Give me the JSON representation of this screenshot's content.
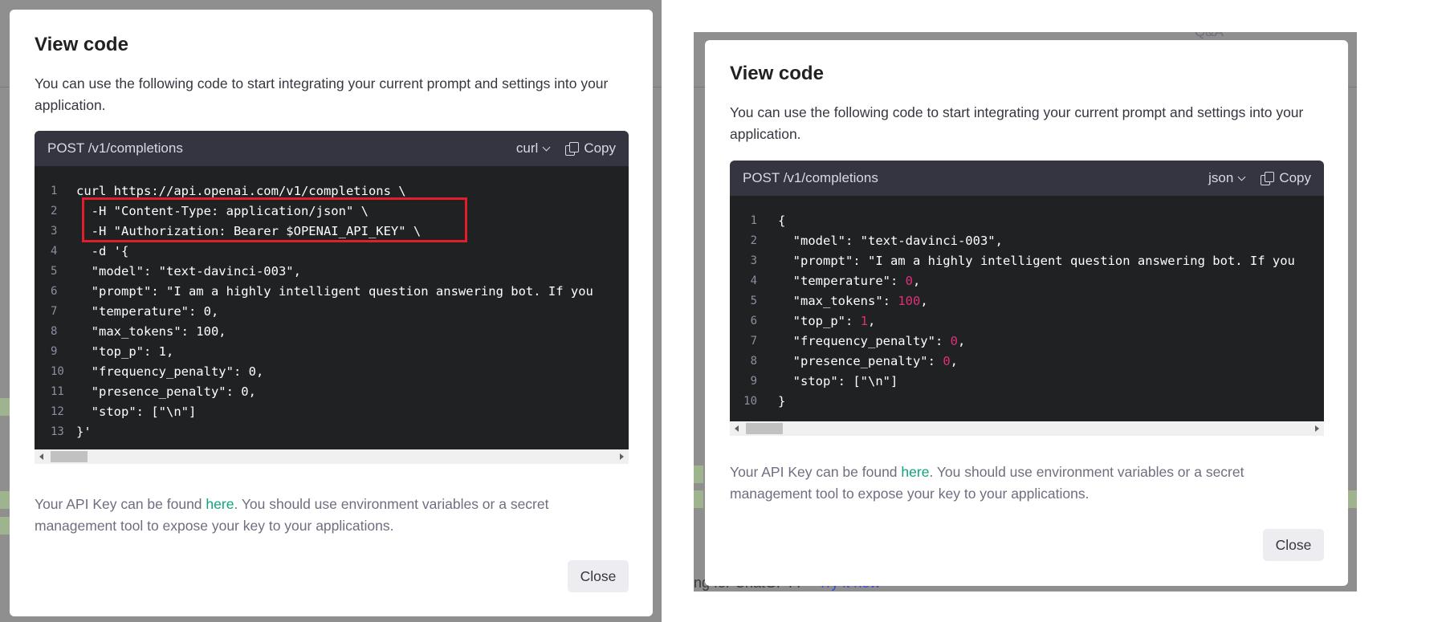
{
  "left": {
    "title": "View code",
    "description": "You can use the following code to start integrating your current prompt and settings into your application.",
    "endpoint": "POST /v1/completions",
    "language": "curl",
    "copy_label": "Copy",
    "code_lines": [
      {
        "n": "1",
        "text": "curl https://api.openai.com/v1/completions \\"
      },
      {
        "n": "2",
        "text": "  -H \"Content-Type: application/json\" \\"
      },
      {
        "n": "3",
        "text": "  -H \"Authorization: Bearer $OPENAI_API_KEY\" \\"
      },
      {
        "n": "4",
        "text": "  -d '{"
      },
      {
        "n": "5",
        "text": "  \"model\": \"text-davinci-003\","
      },
      {
        "n": "6",
        "text": "  \"prompt\": \"I am a highly intelligent question answering bot. If you"
      },
      {
        "n": "7",
        "text": "  \"temperature\": 0,"
      },
      {
        "n": "8",
        "text": "  \"max_tokens\": 100,"
      },
      {
        "n": "9",
        "text": "  \"top_p\": 1,"
      },
      {
        "n": "10",
        "text": "  \"frequency_penalty\": 0,"
      },
      {
        "n": "11",
        "text": "  \"presence_penalty\": 0,"
      },
      {
        "n": "12",
        "text": "  \"stop\": [\"\\n\"]"
      },
      {
        "n": "13",
        "text": "}'"
      }
    ],
    "note_before": "Your API Key can be found ",
    "note_link": "here",
    "note_after": ". You should use environment variables or a secret management tool to expose your key to your applications.",
    "close_label": "Close"
  },
  "right": {
    "title": "View code",
    "description": "You can use the following code to start integrating your current prompt and settings into your application.",
    "endpoint": "POST /v1/completions",
    "language": "json",
    "copy_label": "Copy",
    "code_lines": [
      {
        "n": "1",
        "pre": "{",
        "num": "",
        "post": ""
      },
      {
        "n": "2",
        "pre": "  \"model\": \"text-davinci-003\",",
        "num": "",
        "post": ""
      },
      {
        "n": "3",
        "pre": "  \"prompt\": \"I am a highly intelligent question answering bot. If you",
        "num": "",
        "post": ""
      },
      {
        "n": "4",
        "pre": "  \"temperature\": ",
        "num": "0",
        "post": ","
      },
      {
        "n": "5",
        "pre": "  \"max_tokens\": ",
        "num": "100",
        "post": ","
      },
      {
        "n": "6",
        "pre": "  \"top_p\": ",
        "num": "1",
        "post": ","
      },
      {
        "n": "7",
        "pre": "  \"frequency_penalty\": ",
        "num": "0",
        "post": ","
      },
      {
        "n": "8",
        "pre": "  \"presence_penalty\": ",
        "num": "0",
        "post": ","
      },
      {
        "n": "9",
        "pre": "  \"stop\": [\"\\n\"]",
        "num": "",
        "post": ""
      },
      {
        "n": "10",
        "pre": "}",
        "num": "",
        "post": ""
      }
    ],
    "note_before": "Your API Key can be found ",
    "note_link": "here",
    "note_after": ". You should use environment variables or a secret management tool to expose your key to your applications.",
    "close_label": "Close"
  },
  "background": {
    "field_text": "Q&A",
    "chatgpt_prompt": "ng for ChatGPT?",
    "try_link": "Try it now"
  },
  "colors": {
    "code_bg": "#202123",
    "header_bg": "#343541",
    "number_color": "#df3079",
    "link_color": "#10a37f",
    "highlight_border": "#e01e2c"
  }
}
